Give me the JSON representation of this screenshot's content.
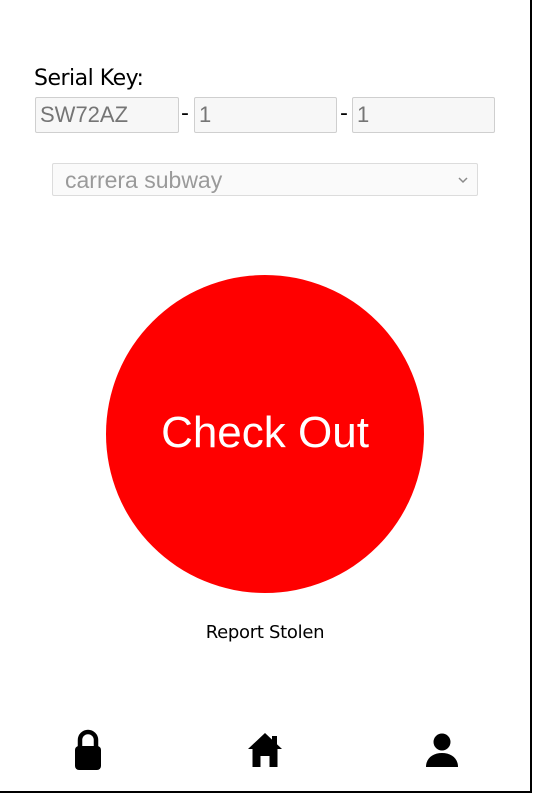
{
  "serial": {
    "label": "Serial Key:",
    "segments": [
      "SW72AZ",
      "1",
      "1"
    ],
    "separator": "-"
  },
  "route_select": {
    "value": "carrera subway"
  },
  "checkout": {
    "label": "Check Out",
    "color": "#ff0000"
  },
  "report_stolen": {
    "label": "Report Stolen"
  },
  "nav": {
    "items": [
      {
        "icon": "lock-icon"
      },
      {
        "icon": "home-icon"
      },
      {
        "icon": "user-icon"
      }
    ]
  }
}
